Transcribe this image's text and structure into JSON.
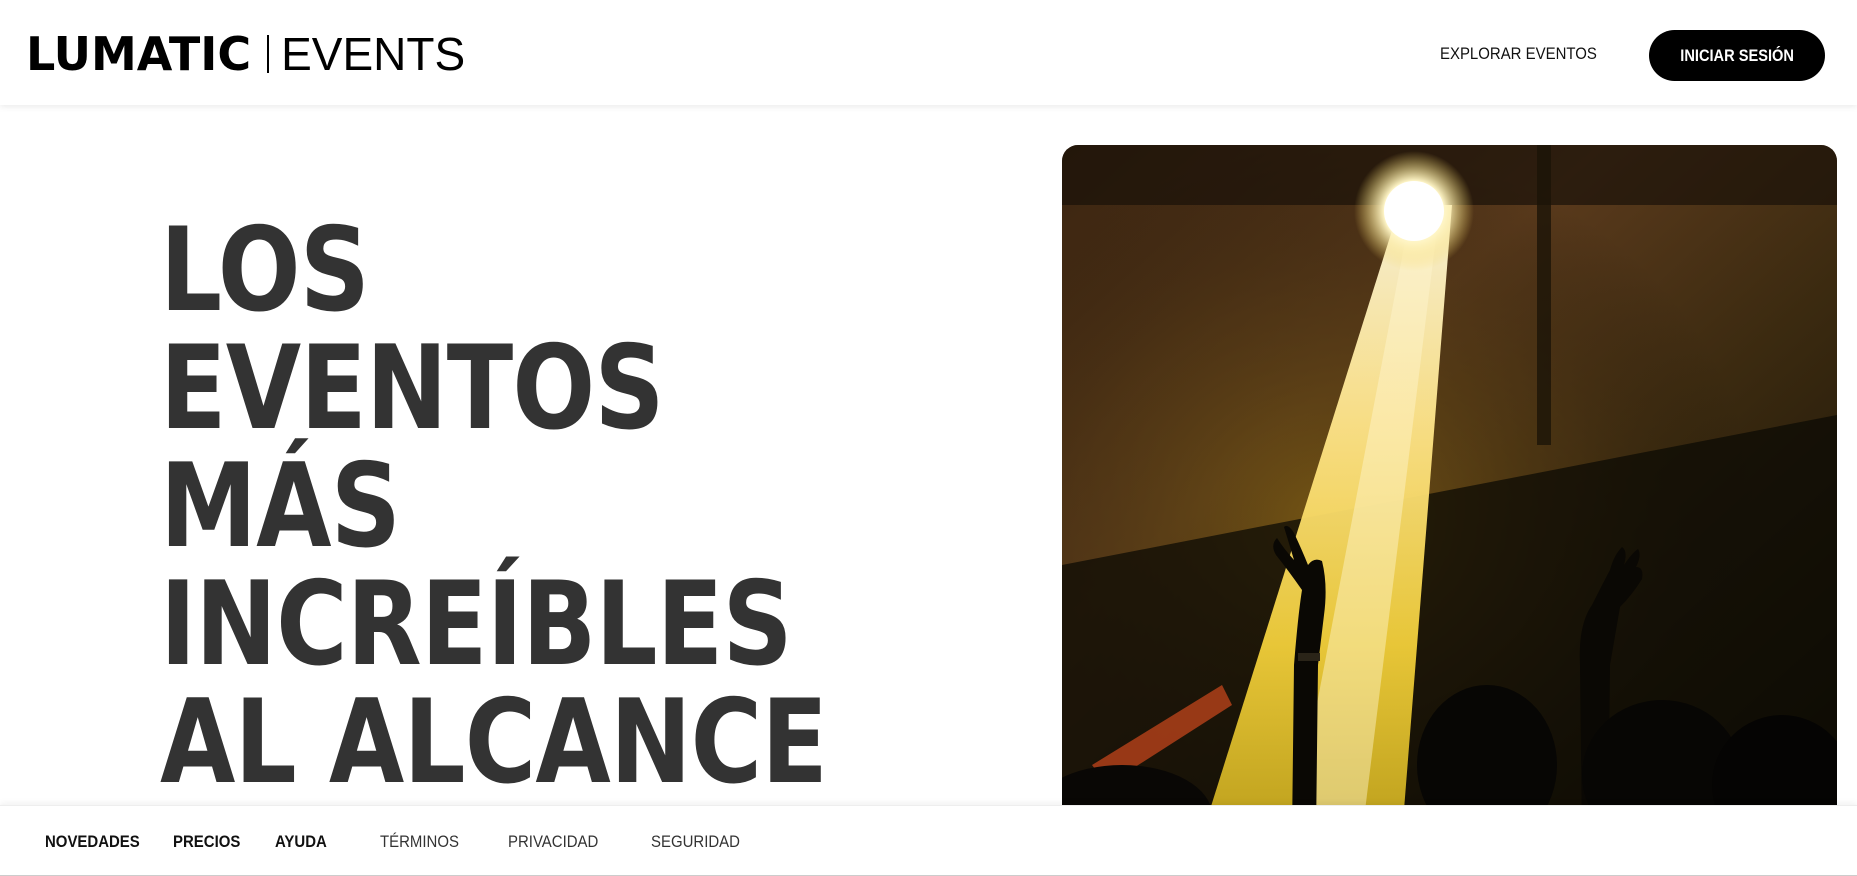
{
  "header": {
    "logo_bold": "LUMATIC",
    "logo_light": "EVENTS",
    "nav_link": "EXPLORAR EVENTOS",
    "login_button": "INICIAR SESIÓN"
  },
  "hero": {
    "title_lines": [
      "LOS",
      "EVENTOS",
      "MÁS",
      "INCREÍBLES",
      "AL ALCANCE"
    ],
    "image": "concert-crowd-spotlight"
  },
  "footer": {
    "links": [
      "NOVEDADES",
      "PRECIOS",
      "AYUDA",
      "TÉRMINOS",
      "PRIVACIDAD",
      "SEGURIDAD"
    ]
  },
  "colors": {
    "brand": "#000000",
    "hero_text": "#333333",
    "spotlight": "#f2d23a"
  }
}
